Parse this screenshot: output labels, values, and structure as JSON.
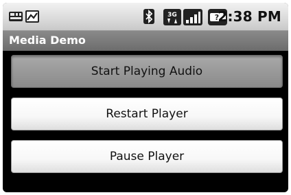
{
  "status_bar": {
    "time": "2:38 PM",
    "left_icons": [
      "keyboard-icon",
      "notification-photo-icon"
    ],
    "right_icons": [
      "bluetooth-icon",
      "network-3g-icon",
      "signal-icon",
      "battery-unknown-icon"
    ],
    "network_label": "3G",
    "battery_label": "?"
  },
  "app": {
    "title": "Media Demo"
  },
  "buttons": [
    {
      "label": "Start Playing Audio",
      "state": "pressed"
    },
    {
      "label": "Restart Player",
      "state": "normal"
    },
    {
      "label": "Pause Player",
      "state": "normal"
    }
  ],
  "colors": {
    "status_bar": "#d9d9d9",
    "title_bar": "#7a7a7a",
    "background": "#000000",
    "button_pressed": "#8a8a8a",
    "button_normal": "#f7f7f7"
  }
}
